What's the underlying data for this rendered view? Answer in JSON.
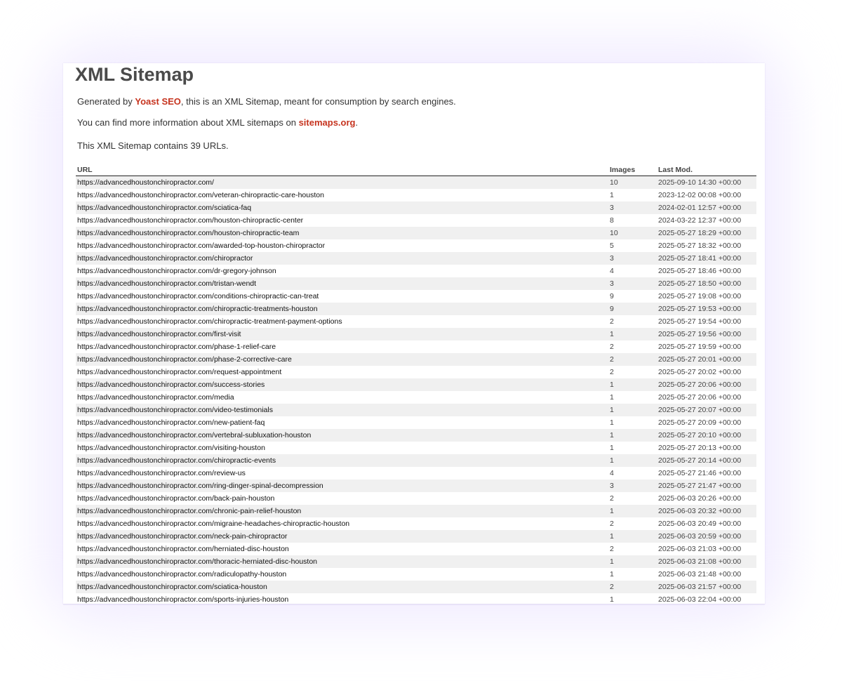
{
  "page": {
    "title": "XML Sitemap",
    "intro_prefix": "Generated by ",
    "yoast_link": "Yoast SEO",
    "intro_suffix": ", this is an XML Sitemap, meant for consumption by search engines.",
    "info_prefix": "You can find more information about XML sitemaps on ",
    "sitemaps_link": "sitemaps.org",
    "info_suffix": ".",
    "count_text": "This XML Sitemap contains 39 URLs."
  },
  "colors": {
    "link_accent": "#c6341f",
    "row_stripe": "#f0f0f0",
    "title": "#4a4a4a"
  },
  "table": {
    "headers": {
      "url": "URL",
      "images": "Images",
      "last_mod": "Last Mod."
    },
    "rows": [
      {
        "url": "https://advancedhoustonchiropractor.com/",
        "images": "10",
        "lastmod": "2025-09-10 14:30 +00:00"
      },
      {
        "url": "https://advancedhoustonchiropractor.com/veteran-chiropractic-care-houston",
        "images": "1",
        "lastmod": "2023-12-02 00:08 +00:00"
      },
      {
        "url": "https://advancedhoustonchiropractor.com/sciatica-faq",
        "images": "3",
        "lastmod": "2024-02-01 12:57 +00:00"
      },
      {
        "url": "https://advancedhoustonchiropractor.com/houston-chiropractic-center",
        "images": "8",
        "lastmod": "2024-03-22 12:37 +00:00"
      },
      {
        "url": "https://advancedhoustonchiropractor.com/houston-chiropractic-team",
        "images": "10",
        "lastmod": "2025-05-27 18:29 +00:00"
      },
      {
        "url": "https://advancedhoustonchiropractor.com/awarded-top-houston-chiropractor",
        "images": "5",
        "lastmod": "2025-05-27 18:32 +00:00"
      },
      {
        "url": "https://advancedhoustonchiropractor.com/chiropractor",
        "images": "3",
        "lastmod": "2025-05-27 18:41 +00:00"
      },
      {
        "url": "https://advancedhoustonchiropractor.com/dr-gregory-johnson",
        "images": "4",
        "lastmod": "2025-05-27 18:46 +00:00"
      },
      {
        "url": "https://advancedhoustonchiropractor.com/tristan-wendt",
        "images": "3",
        "lastmod": "2025-05-27 18:50 +00:00"
      },
      {
        "url": "https://advancedhoustonchiropractor.com/conditions-chiropractic-can-treat",
        "images": "9",
        "lastmod": "2025-05-27 19:08 +00:00"
      },
      {
        "url": "https://advancedhoustonchiropractor.com/chiropractic-treatments-houston",
        "images": "9",
        "lastmod": "2025-05-27 19:53 +00:00"
      },
      {
        "url": "https://advancedhoustonchiropractor.com/chiropractic-treatment-payment-options",
        "images": "2",
        "lastmod": "2025-05-27 19:54 +00:00"
      },
      {
        "url": "https://advancedhoustonchiropractor.com/first-visit",
        "images": "1",
        "lastmod": "2025-05-27 19:56 +00:00"
      },
      {
        "url": "https://advancedhoustonchiropractor.com/phase-1-relief-care",
        "images": "2",
        "lastmod": "2025-05-27 19:59 +00:00"
      },
      {
        "url": "https://advancedhoustonchiropractor.com/phase-2-corrective-care",
        "images": "2",
        "lastmod": "2025-05-27 20:01 +00:00"
      },
      {
        "url": "https://advancedhoustonchiropractor.com/request-appointment",
        "images": "2",
        "lastmod": "2025-05-27 20:02 +00:00"
      },
      {
        "url": "https://advancedhoustonchiropractor.com/success-stories",
        "images": "1",
        "lastmod": "2025-05-27 20:06 +00:00"
      },
      {
        "url": "https://advancedhoustonchiropractor.com/media",
        "images": "1",
        "lastmod": "2025-05-27 20:06 +00:00"
      },
      {
        "url": "https://advancedhoustonchiropractor.com/video-testimonials",
        "images": "1",
        "lastmod": "2025-05-27 20:07 +00:00"
      },
      {
        "url": "https://advancedhoustonchiropractor.com/new-patient-faq",
        "images": "1",
        "lastmod": "2025-05-27 20:09 +00:00"
      },
      {
        "url": "https://advancedhoustonchiropractor.com/vertebral-subluxation-houston",
        "images": "1",
        "lastmod": "2025-05-27 20:10 +00:00"
      },
      {
        "url": "https://advancedhoustonchiropractor.com/visiting-houston",
        "images": "1",
        "lastmod": "2025-05-27 20:13 +00:00"
      },
      {
        "url": "https://advancedhoustonchiropractor.com/chiropractic-events",
        "images": "1",
        "lastmod": "2025-05-27 20:14 +00:00"
      },
      {
        "url": "https://advancedhoustonchiropractor.com/review-us",
        "images": "4",
        "lastmod": "2025-05-27 21:46 +00:00"
      },
      {
        "url": "https://advancedhoustonchiropractor.com/ring-dinger-spinal-decompression",
        "images": "3",
        "lastmod": "2025-05-27 21:47 +00:00"
      },
      {
        "url": "https://advancedhoustonchiropractor.com/back-pain-houston",
        "images": "2",
        "lastmod": "2025-06-03 20:26 +00:00"
      },
      {
        "url": "https://advancedhoustonchiropractor.com/chronic-pain-relief-houston",
        "images": "1",
        "lastmod": "2025-06-03 20:32 +00:00"
      },
      {
        "url": "https://advancedhoustonchiropractor.com/migraine-headaches-chiropractic-houston",
        "images": "2",
        "lastmod": "2025-06-03 20:49 +00:00"
      },
      {
        "url": "https://advancedhoustonchiropractor.com/neck-pain-chiropractor",
        "images": "1",
        "lastmod": "2025-06-03 20:59 +00:00"
      },
      {
        "url": "https://advancedhoustonchiropractor.com/herniated-disc-houston",
        "images": "2",
        "lastmod": "2025-06-03 21:03 +00:00"
      },
      {
        "url": "https://advancedhoustonchiropractor.com/thoracic-herniated-disc-houston",
        "images": "1",
        "lastmod": "2025-06-03 21:08 +00:00"
      },
      {
        "url": "https://advancedhoustonchiropractor.com/radiculopathy-houston",
        "images": "1",
        "lastmod": "2025-06-03 21:48 +00:00"
      },
      {
        "url": "https://advancedhoustonchiropractor.com/sciatica-houston",
        "images": "2",
        "lastmod": "2025-06-03 21:57 +00:00"
      },
      {
        "url": "https://advancedhoustonchiropractor.com/sports-injuries-houston",
        "images": "1",
        "lastmod": "2025-06-03 22:04 +00:00"
      }
    ]
  }
}
